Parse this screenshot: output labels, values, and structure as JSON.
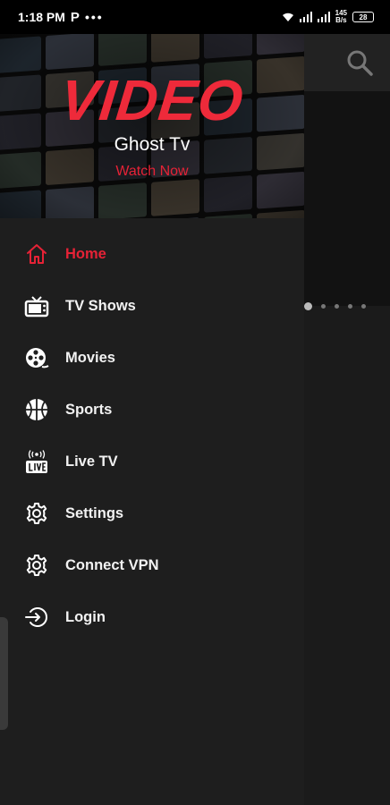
{
  "status_bar": {
    "time": "1:18 PM",
    "app_indicator": "P",
    "more_dots": "•••",
    "net_speed_value": "145",
    "net_speed_unit": "B/s",
    "battery": "28"
  },
  "drawer": {
    "header": {
      "logo": "VIDEO",
      "app_name": "Ghost Tv",
      "cta": "Watch Now"
    },
    "menu": [
      {
        "label": "Home",
        "icon": "home-icon",
        "active": true
      },
      {
        "label": "TV Shows",
        "icon": "tv-icon",
        "active": false
      },
      {
        "label": "Movies",
        "icon": "film-reel-icon",
        "active": false
      },
      {
        "label": "Sports",
        "icon": "basketball-icon",
        "active": false
      },
      {
        "label": "Live TV",
        "icon": "live-tv-icon",
        "active": false
      },
      {
        "label": "Settings",
        "icon": "gear-icon",
        "active": false
      },
      {
        "label": "Connect VPN",
        "icon": "gear-icon",
        "active": false
      },
      {
        "label": "Login",
        "icon": "login-icon",
        "active": false
      }
    ]
  },
  "colors": {
    "accent": "#e62236",
    "logo": "#ee2a3a",
    "drawer_bg": "#1e1e1e",
    "app_bg": "#1b1b1b"
  }
}
